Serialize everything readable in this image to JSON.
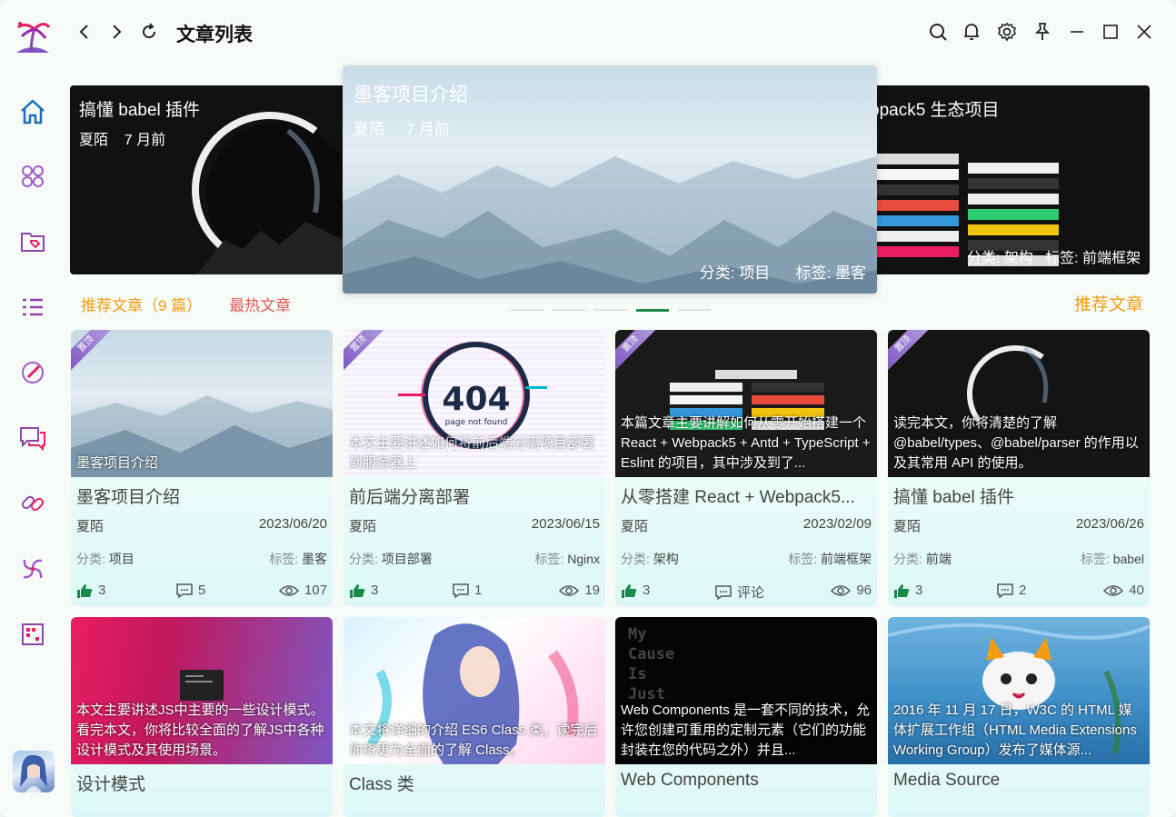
{
  "title": "文章列表",
  "carousel": [
    {
      "title": "搞懂 babel 插件",
      "author": "夏陌",
      "time": "7 月前"
    },
    {
      "title": "墨客项目介绍",
      "author": "夏陌",
      "time": "7 月前",
      "category": "分类: 项目",
      "tag": "标签: 墨客"
    },
    {
      "title": "bpack5 生态项目",
      "category": "分类: 架构",
      "tag": "标签: 前端框架"
    }
  ],
  "tabs": {
    "recommend": "推荐文章（9 篇）",
    "hot": "最热文章"
  },
  "section_label": "推荐文章",
  "pin_label": "置顶",
  "cat_prefix": "分类: ",
  "tag_prefix": "标签: ",
  "cards": [
    {
      "title": "墨客项目介绍",
      "desc": "墨客项目介绍",
      "author": "夏陌",
      "date": "2023/06/20",
      "category": "项目",
      "tag": "墨客",
      "likes": "3",
      "comments": "5",
      "views": "107"
    },
    {
      "title": "前后端分离部署",
      "desc": "本文主要讲述如何将前后端分离项目部署到服务器上",
      "author": "夏陌",
      "date": "2023/06/15",
      "category": "项目部署",
      "tag": "Nginx",
      "likes": "3",
      "comments": "1",
      "views": "19"
    },
    {
      "title": "从零搭建 React + Webpack5...",
      "desc": "本篇文章主要讲解如何从零开始搭建一个 React + Webpack5 + Antd + TypeScript + Eslint 的项目，其中涉及到了...",
      "author": "夏陌",
      "date": "2023/02/09",
      "category": "架构",
      "tag": "前端框架",
      "likes": "3",
      "comments": "评论",
      "views": "96"
    },
    {
      "title": "搞懂 babel 插件",
      "desc": "读完本文，你将清楚的了解 @babel/types、@babel/parser 的作用以及其常用 API 的使用。",
      "author": "夏陌",
      "date": "2023/06/26",
      "category": "前端",
      "tag": "babel",
      "likes": "3",
      "comments": "2",
      "views": "40"
    },
    {
      "title": "设计模式",
      "desc": "本文主要讲述JS中主要的一些设计模式。看完本文，你将比较全面的了解JS中各种设计模式及其使用场景。"
    },
    {
      "title": "Class 类",
      "desc": "本文将详细的介绍 ES6 Class 类，读完后你将更为全面的了解 Class。"
    },
    {
      "title": "Web Components",
      "desc": "Web Components 是一套不同的技术，允许您创建可重用的定制元素（它们的功能封装在您的代码之外）并且...",
      "img_text": "My Cause Is Just"
    },
    {
      "title": "Media Source",
      "desc": "2016 年 11 月 17 日，W3C 的 HTML 媒体扩展工作组（HTML Media Extensions Working Group）发布了媒体源..."
    }
  ],
  "page_not_found": {
    "code": "404",
    "text": "page not found"
  },
  "colors": {
    "accent": "#1a8a4a",
    "orange": "#f39c12",
    "red": "#e05a5a",
    "like": "#1a8a4a"
  }
}
